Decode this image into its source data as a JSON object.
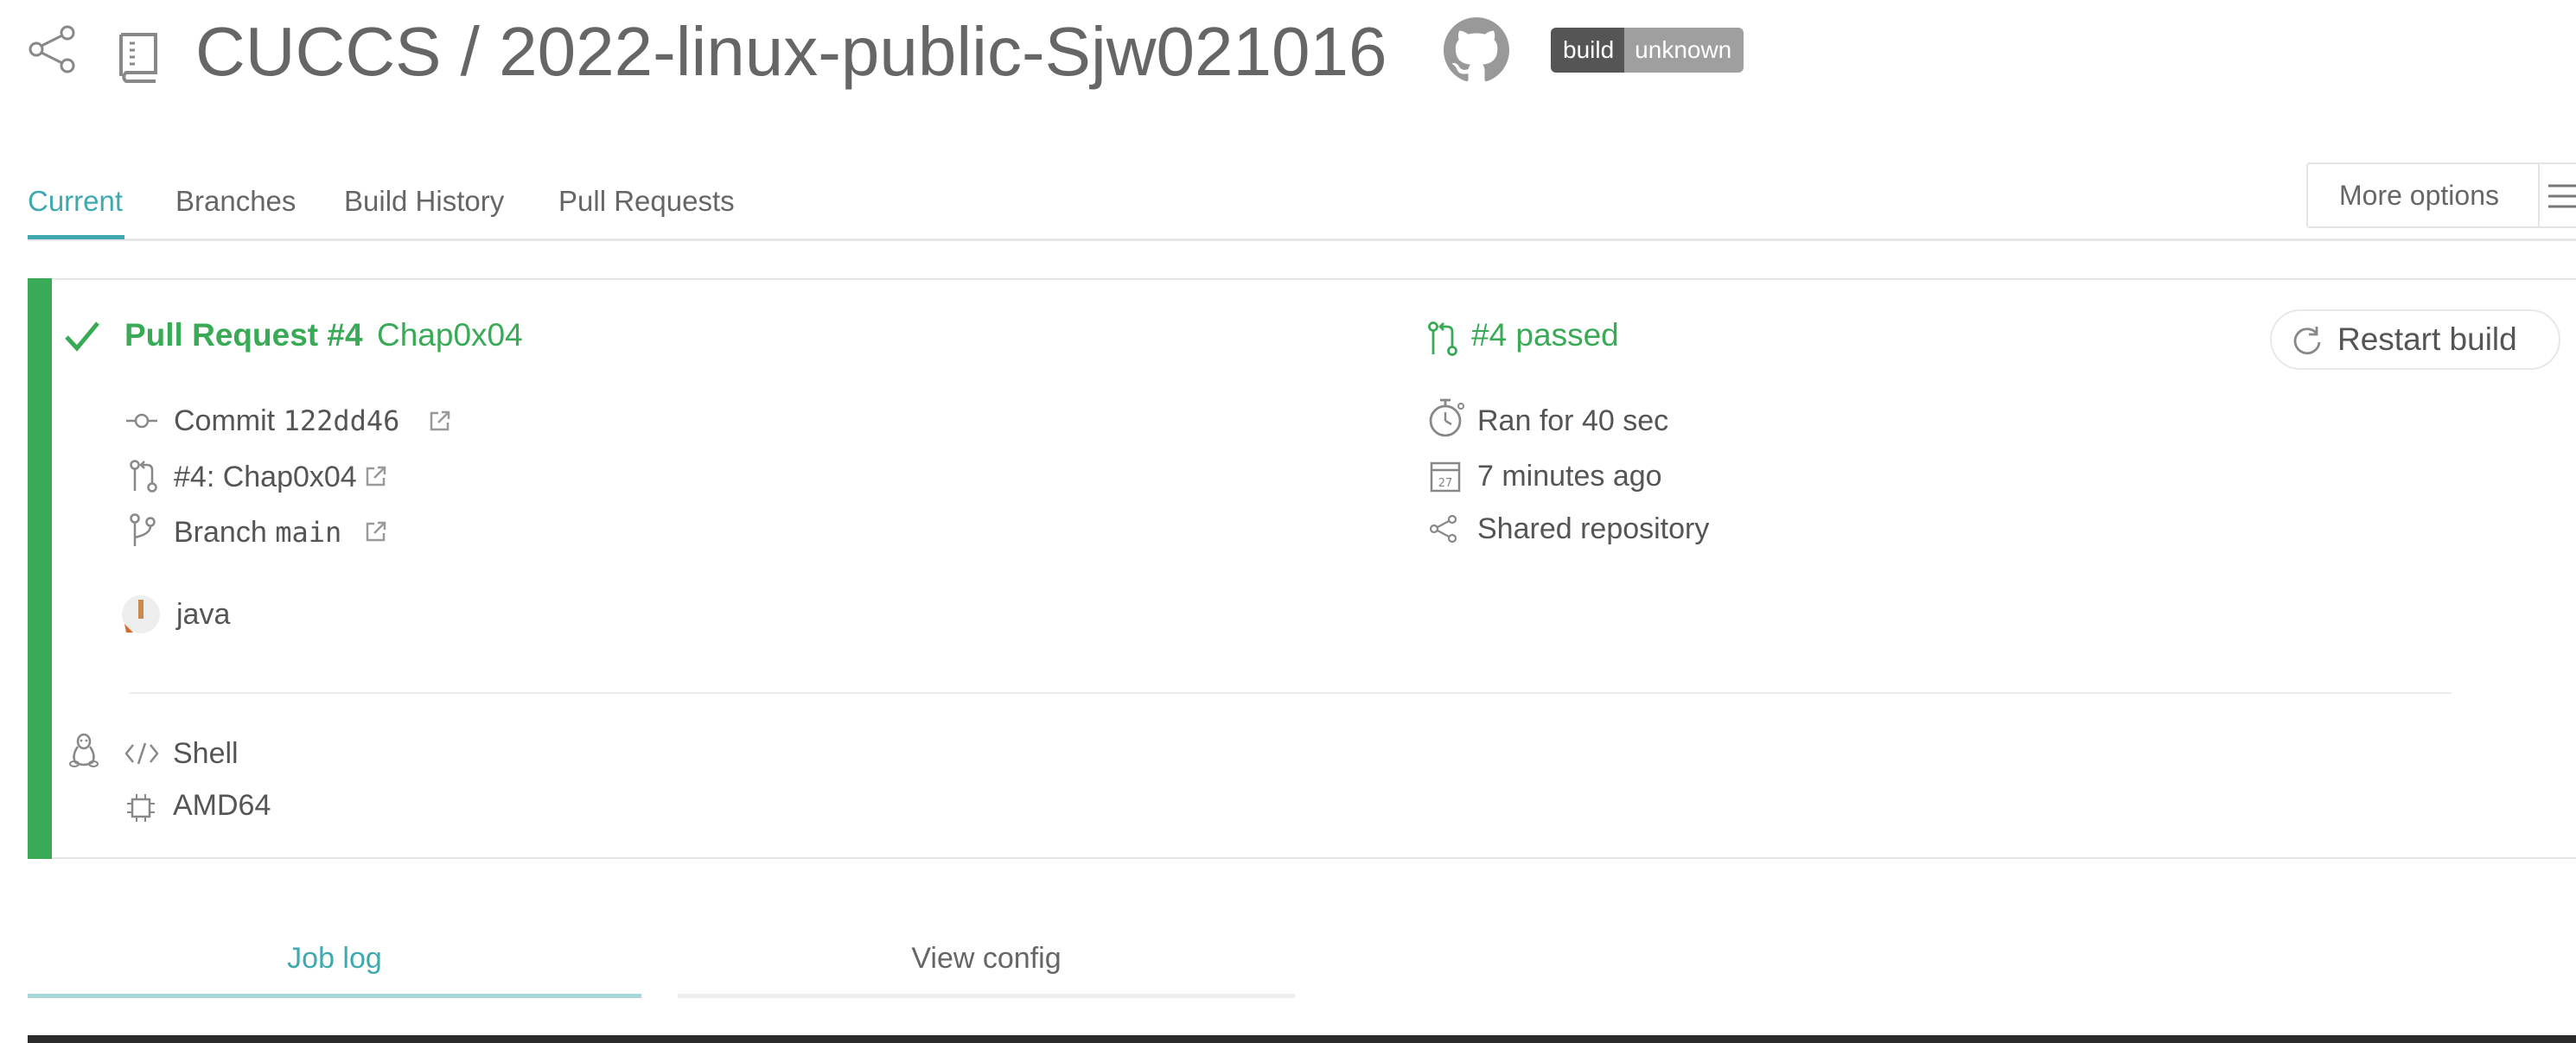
{
  "header": {
    "repo_title": "CUCCS / 2022-linux-public-Sjw021016",
    "badge_left": "build",
    "badge_right": "unknown",
    "icons": [
      "share-icon",
      "repo-icon",
      "github-icon"
    ]
  },
  "tabs": [
    {
      "label": "Current",
      "active": true
    },
    {
      "label": "Branches"
    },
    {
      "label": "Build History"
    },
    {
      "label": "Pull Requests"
    }
  ],
  "more_options": {
    "label": "More options",
    "icon": "menu-icon"
  },
  "build": {
    "status_color": "#39aa56",
    "title": "Pull Request #4",
    "subtitle": "Chap0x04",
    "commit_label": "Commit",
    "commit_hash": "122dd46",
    "pr_ref": "#4: Chap0x04",
    "branch_label": "Branch",
    "branch_name": "main",
    "language": "java",
    "os_icon": "linux-icon",
    "language_type": "Shell",
    "arch": "AMD64",
    "pr_status": "#4 passed",
    "duration": "Ran for 40 sec",
    "finished": "7 minutes ago",
    "calendar_day": "27",
    "shared": "Shared repository",
    "restart_label": "Restart build"
  },
  "log_tabs": [
    {
      "label": "Job log",
      "active": true
    },
    {
      "label": "View config"
    }
  ],
  "colors": {
    "accent": "#3eaaaf",
    "passed": "#39aa56",
    "text": "#666666"
  }
}
